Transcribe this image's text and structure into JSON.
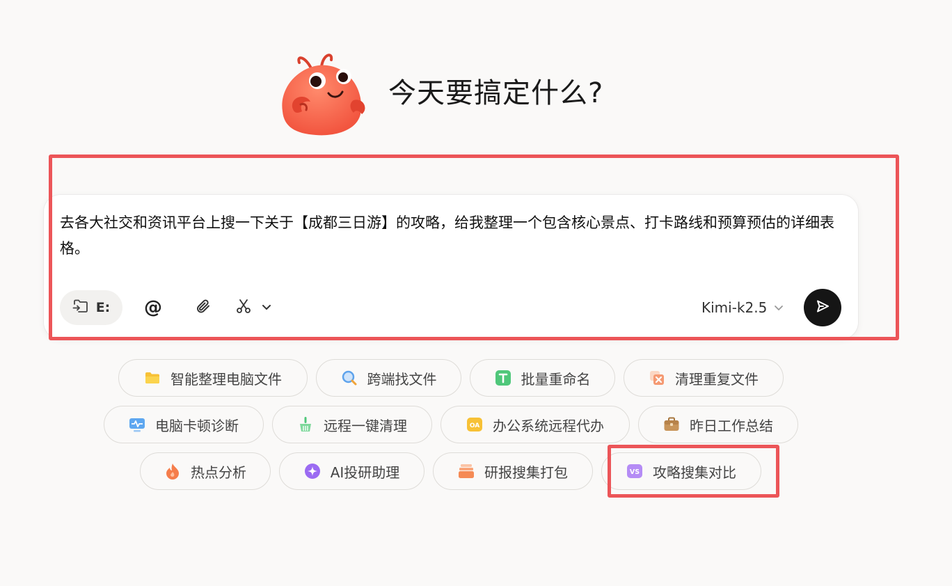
{
  "header": {
    "headline": "今天要搞定什么?"
  },
  "composer": {
    "prompt": "去各大社交和资讯平台上搜一下关于【成都三日游】的攻略，给我整理一个包含核心景点、打卡路线和预算预估的详细表格。",
    "folder_label": "E:",
    "model": "Kimi-k2.5"
  },
  "suggestions": [
    {
      "label": "智能整理电脑文件",
      "icon": "folder-icon"
    },
    {
      "label": "跨端找文件",
      "icon": "search-icon"
    },
    {
      "label": "批量重命名",
      "icon": "t-letter-icon"
    },
    {
      "label": "清理重复文件",
      "icon": "duplicate-delete-icon"
    },
    {
      "label": "电脑卡顿诊断",
      "icon": "monitor-pulse-icon"
    },
    {
      "label": "远程一键清理",
      "icon": "broom-icon"
    },
    {
      "label": "办公系统远程代办",
      "icon": "oa-icon"
    },
    {
      "label": "昨日工作总结",
      "icon": "briefcase-icon"
    },
    {
      "label": "热点分析",
      "icon": "flame-icon"
    },
    {
      "label": "AI投研助理",
      "icon": "sparkle-icon"
    },
    {
      "label": "研报搜集打包",
      "icon": "stack-icon"
    },
    {
      "label": "攻略搜集对比",
      "icon": "vs-icon"
    }
  ],
  "colors": {
    "highlight": "#ec5558",
    "send_button": "#151515",
    "mascot": "#f86b52"
  }
}
